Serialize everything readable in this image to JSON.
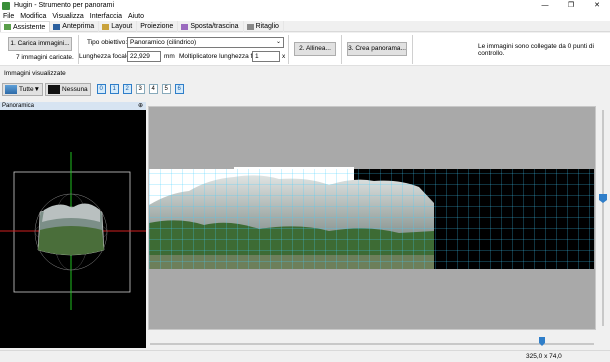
{
  "window": {
    "title": "Hugin - Strumento per panorami",
    "controls": [
      "—",
      "❐",
      "✕"
    ]
  },
  "menu": [
    "File",
    "Modifica",
    "Visualizza",
    "Interfaccia",
    "Aiuto"
  ],
  "tabs": [
    {
      "label": "Assistente",
      "icon": "wand-icon",
      "active": true
    },
    {
      "label": "Anteprima",
      "icon": "preview-icon",
      "active": false
    },
    {
      "label": "Layout",
      "icon": "layout-icon",
      "active": false
    },
    {
      "label": "Proiezione",
      "icon": "projection-icon",
      "active": false
    },
    {
      "label": "Sposta/trascina",
      "icon": "move-icon",
      "active": false
    },
    {
      "label": "Ritaglio",
      "icon": "crop-icon",
      "active": false
    }
  ],
  "assistant": {
    "load_button": "1. Carica immagini...",
    "loaded_text": "7 immagini caricate.",
    "lens_type_label": "Tipo obiettivo:",
    "lens_type_value": "Panoramico (cilindrico)",
    "focal_length_label": "Lunghezza focale:",
    "focal_length_value": "22,929",
    "focal_unit": "mm",
    "multiplier_label": "Moltiplicatore lunghezza focale:",
    "multiplier_value": "1",
    "multiplier_unit": "x",
    "align_button": "2. Allinea...",
    "create_button": "3. Crea panorama...",
    "status_message": "Le immagini sono collegate da 0 punti di controllo."
  },
  "visible_images": {
    "label": "Immagini visualizzate",
    "all_button": "Tutte▼",
    "none_button": "Nessuna",
    "numbers": [
      {
        "n": "0",
        "on": true
      },
      {
        "n": "1",
        "on": true
      },
      {
        "n": "2",
        "on": true
      },
      {
        "n": "3",
        "on": false
      },
      {
        "n": "4",
        "on": false
      },
      {
        "n": "5",
        "on": false
      },
      {
        "n": "6",
        "on": true
      }
    ]
  },
  "overview_panel": {
    "title": "Panoramica",
    "pin": "⊕"
  },
  "status_bar": {
    "dimensions": "325,0 x 74,0"
  },
  "colors": {
    "accent": "#2f7ec9",
    "grid": "#40d0ff",
    "overview_axis_red": "#d02020",
    "overview_axis_green": "#20c020"
  }
}
